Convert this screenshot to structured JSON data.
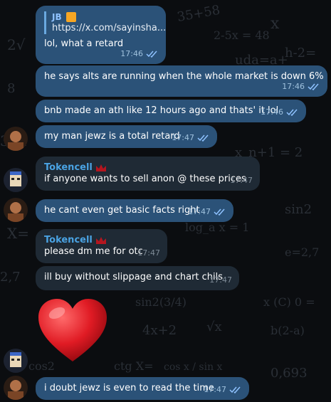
{
  "chat": {
    "messages": [
      {
        "reply_name": "JB",
        "reply_text": "https://x.com/sayinsha...",
        "text": "lol, what a retard",
        "time": "17:46"
      },
      {
        "text": "he says alts are running when the whole market is down 6%",
        "time": "17:46"
      },
      {
        "text": "bnb made an ath like 12 hours ago and thats' it lol",
        "time": "17:46"
      },
      {
        "text": "my man jewz is a total retard",
        "time": "17:47"
      },
      {
        "sender": "Tokencell",
        "text": "if anyone wants to sell anon @ these prices",
        "time": "17:47"
      },
      {
        "text": "he cant even get basic facts right",
        "time": "17:47"
      },
      {
        "sender": "Tokencell",
        "text": "please dm me for otc",
        "time": "17:47"
      },
      {
        "text": "ill buy without slippage and chart chils",
        "time": "17:47"
      },
      {
        "sticker": "red-heart-icon"
      },
      {
        "text": "i doubt jewz is even to read the time",
        "time": "17:47"
      }
    ]
  }
}
